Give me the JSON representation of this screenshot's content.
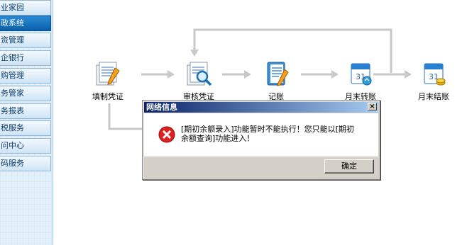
{
  "sidebar": {
    "items": [
      {
        "label": "业家园"
      },
      {
        "label": "政系统"
      },
      {
        "label": "资管理"
      },
      {
        "label": "企银行"
      },
      {
        "label": "购管理"
      },
      {
        "label": "务管家"
      },
      {
        "label": "务报表"
      },
      {
        "label": "税服务"
      },
      {
        "label": "问中心"
      },
      {
        "label": "码服务"
      }
    ]
  },
  "flow": {
    "nodes": [
      {
        "label": "填制凭证",
        "icon": "document-pen-icon"
      },
      {
        "label": "审核凭证",
        "icon": "document-search-icon"
      },
      {
        "label": "记账",
        "icon": "notebook-pen-icon"
      },
      {
        "label": "月末转账",
        "icon": "calendar-transfer-icon"
      },
      {
        "label": "月末结账",
        "icon": "calendar-coins-icon"
      }
    ]
  },
  "dialog": {
    "title": "网络信息",
    "close": "×",
    "message": "[期初余额录入]功能暂时不能执行！您只能以[期初余额查询]功能进入！",
    "ok_label": "确定",
    "icon": "error-icon"
  },
  "colors": {
    "sidebar_active": "#0a5fa8",
    "title_bar": "#0a246a",
    "flow_arrow": "#c8c8c8"
  }
}
